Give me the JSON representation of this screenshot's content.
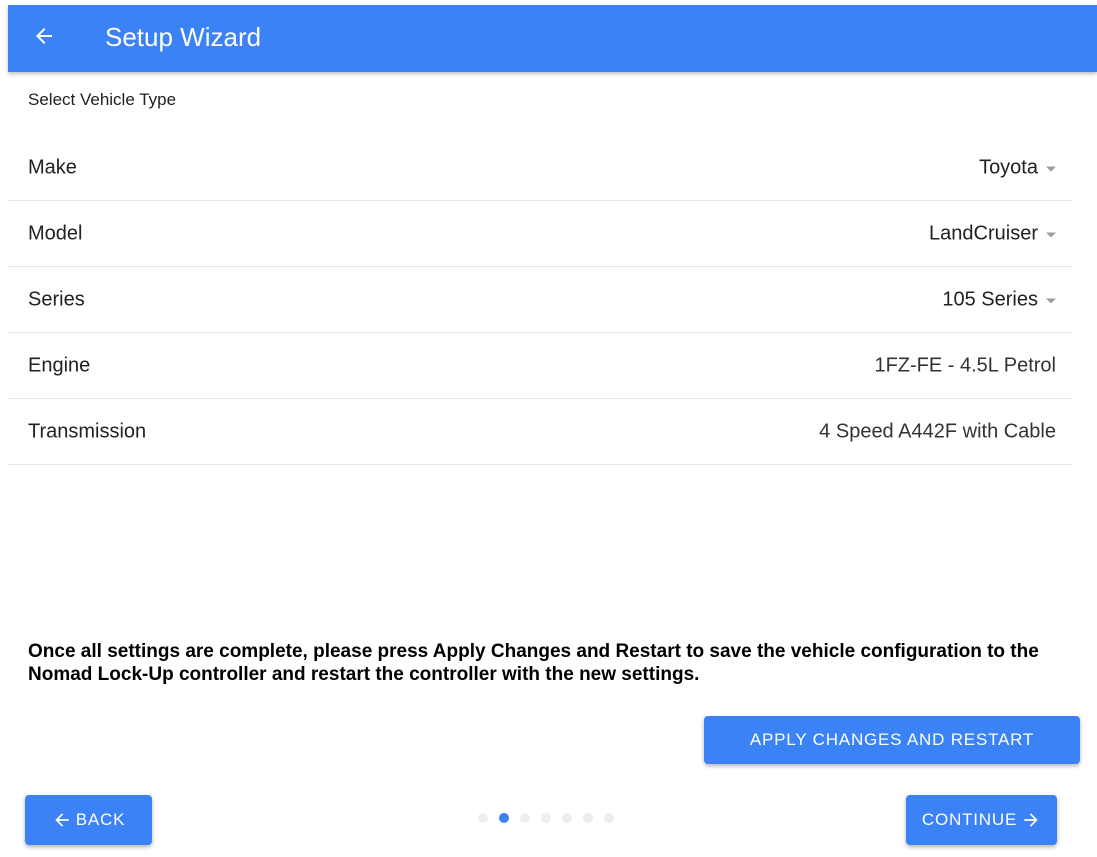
{
  "header": {
    "title": "Setup Wizard",
    "color": "#3b82f6"
  },
  "section_title": "Select Vehicle Type",
  "fields": [
    {
      "label": "Make",
      "value": "Toyota",
      "dropdown": true
    },
    {
      "label": "Model",
      "value": "LandCruiser",
      "dropdown": true
    },
    {
      "label": "Series",
      "value": "105 Series",
      "dropdown": true
    },
    {
      "label": "Engine",
      "value": "1FZ-FE - 4.5L Petrol",
      "dropdown": false
    },
    {
      "label": "Transmission",
      "value": "4 Speed A442F with Cable",
      "dropdown": false
    }
  ],
  "notice": "Once all settings are complete, please press Apply Changes and Restart to save the vehicle configuration to the Nomad Lock-Up controller and restart the controller with the new settings.",
  "buttons": {
    "apply": "APPLY CHANGES AND RESTART",
    "back": "BACK",
    "continue": "CONTINUE"
  },
  "stepper": {
    "total_steps": 7,
    "current_step": 2
  },
  "icons": {
    "header_back": "arrow-left-icon",
    "back_button": "arrow-left-icon",
    "continue_button": "arrow-right-icon",
    "dropdown": "caret-down-icon"
  }
}
